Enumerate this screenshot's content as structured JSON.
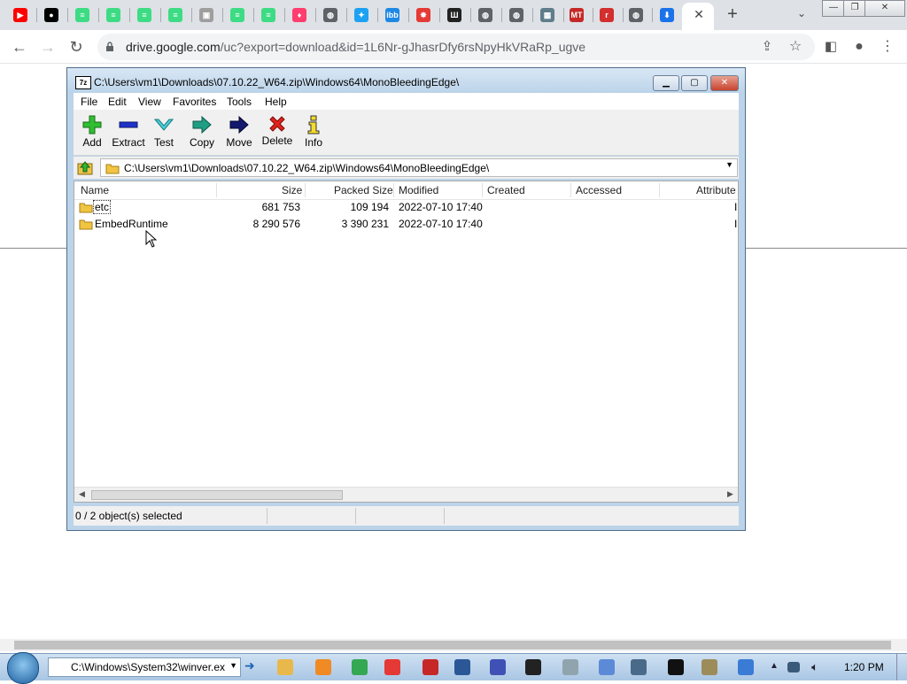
{
  "browser": {
    "tabs": [
      {
        "icon": "youtube-icon",
        "color": "#ff0000",
        "glyph": "▶"
      },
      {
        "icon": "github-icon",
        "color": "#000000",
        "glyph": "●"
      },
      {
        "icon": "f-logo-icon",
        "color": "#3ddc84",
        "glyph": "≡"
      },
      {
        "icon": "f-logo-icon",
        "color": "#3ddc84",
        "glyph": "≡"
      },
      {
        "icon": "f-logo-icon",
        "color": "#3ddc84",
        "glyph": "≡"
      },
      {
        "icon": "f-logo-icon",
        "color": "#3ddc84",
        "glyph": "≡"
      },
      {
        "icon": "image-icon",
        "color": "#9e9e9e",
        "glyph": "▣"
      },
      {
        "icon": "f-logo-icon",
        "color": "#3ddc84",
        "glyph": "≡"
      },
      {
        "icon": "f-logo-icon",
        "color": "#3ddc84",
        "glyph": "≡"
      },
      {
        "icon": "flame-icon",
        "color": "#ff3d6e",
        "glyph": "♦"
      },
      {
        "icon": "globe-icon",
        "color": "#5f6368",
        "glyph": "◍"
      },
      {
        "icon": "twitter-icon",
        "color": "#1da1f2",
        "glyph": "✦"
      },
      {
        "icon": "ibb-icon",
        "color": "#1e88e5",
        "glyph": "ibb"
      },
      {
        "icon": "bug-icon",
        "color": "#e53935",
        "glyph": "✸"
      },
      {
        "icon": "archive-icon",
        "color": "#222222",
        "glyph": "Ш"
      },
      {
        "icon": "globe-icon",
        "color": "#5f6368",
        "glyph": "◍"
      },
      {
        "icon": "globe-icon",
        "color": "#5f6368",
        "glyph": "◍"
      },
      {
        "icon": "screenshot-icon",
        "color": "#607d8b",
        "glyph": "▦"
      },
      {
        "icon": "mt-icon",
        "color": "#c62828",
        "glyph": "MT"
      },
      {
        "icon": "r-icon",
        "color": "#d32f2f",
        "glyph": "r"
      },
      {
        "icon": "globe-icon",
        "color": "#5f6368",
        "glyph": "◍"
      },
      {
        "icon": "download-icon",
        "color": "#1a73e8",
        "glyph": "⬇"
      }
    ],
    "active_tab_close": "✕",
    "new_tab": "+",
    "tab_search": "⌄",
    "url_host": "drive.google.com",
    "url_path": "/uc?export=download&id=1L6Nr-gJhasrDfy6rsNpyHkVRaRp_ugve"
  },
  "sevenzip": {
    "title": "C:\\Users\\vm1\\Downloads\\07.10.22_W64.zip\\Windows64\\MonoBleedingEdge\\",
    "logo": "7z",
    "menu": [
      "File",
      "Edit",
      "View",
      "Favorites",
      "Tools",
      "Help"
    ],
    "toolbar": [
      "Add",
      "Extract",
      "Test",
      "Copy",
      "Move",
      "Delete",
      "Info"
    ],
    "path": "C:\\Users\\vm1\\Downloads\\07.10.22_W64.zip\\Windows64\\MonoBleedingEdge\\",
    "columns": [
      "Name",
      "Size",
      "Packed Size",
      "Modified",
      "Created",
      "Accessed",
      "Attribute"
    ],
    "rows": [
      {
        "name": "etc",
        "size": "681 753",
        "packed": "109 194",
        "modified": "2022-07-10 17:40"
      },
      {
        "name": "EmbedRuntime",
        "size": "8 290 576",
        "packed": "3 390 231",
        "modified": "2022-07-10 17:40"
      }
    ],
    "status": "0 / 2 object(s) selected"
  },
  "taskbar": {
    "run_value": "C:\\Windows\\System32\\winver.ex",
    "clock": "1:20 PM",
    "icons": [
      {
        "icon": "explorer-icon",
        "color": "#e8b84a"
      },
      {
        "icon": "media-player-icon",
        "color": "#f08a24"
      },
      {
        "icon": "chrome-icon",
        "color": "#34a853"
      },
      {
        "icon": "opera-icon",
        "color": "#e53935"
      },
      {
        "icon": "acrobat-icon",
        "color": "#c62828"
      },
      {
        "icon": "powershell-icon",
        "color": "#2b5797"
      },
      {
        "icon": "app-a-icon",
        "color": "#3f51b5"
      },
      {
        "icon": "sevenzip-icon",
        "color": "#222222"
      },
      {
        "icon": "notepad-icon",
        "color": "#90a4ae"
      },
      {
        "icon": "document-icon",
        "color": "#5c8ad6"
      },
      {
        "icon": "window-icon",
        "color": "#4a6a8a"
      },
      {
        "icon": "grid-icon",
        "color": "#111111"
      },
      {
        "icon": "network-app-icon",
        "color": "#9c8c5a"
      },
      {
        "icon": "monitor-icon",
        "color": "#3a7bd5"
      }
    ]
  }
}
